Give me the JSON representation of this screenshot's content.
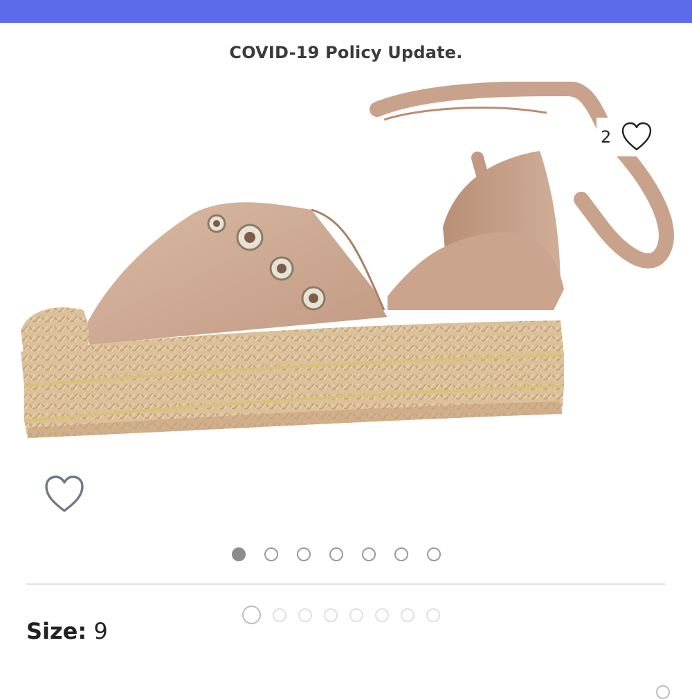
{
  "header": {
    "policy_text": "COVID-19 Policy Update."
  },
  "listing": {
    "like_count": "2",
    "image_alt": "Tan suede espadrille flat with ankle wrap ties and grommets",
    "carousel": {
      "total": 7,
      "active_index": 0
    },
    "thumbnails": {
      "total": 8,
      "active_index": 0
    },
    "size_label": "Size:",
    "size_value": "9"
  },
  "colors": {
    "top_bar": "#5c6bea",
    "suede": "#c9a48d",
    "jute": "#d7b98f",
    "gold": "#d9c37a"
  },
  "icons": {
    "like": "heart-outline-icon",
    "save": "heart-outline-icon"
  }
}
